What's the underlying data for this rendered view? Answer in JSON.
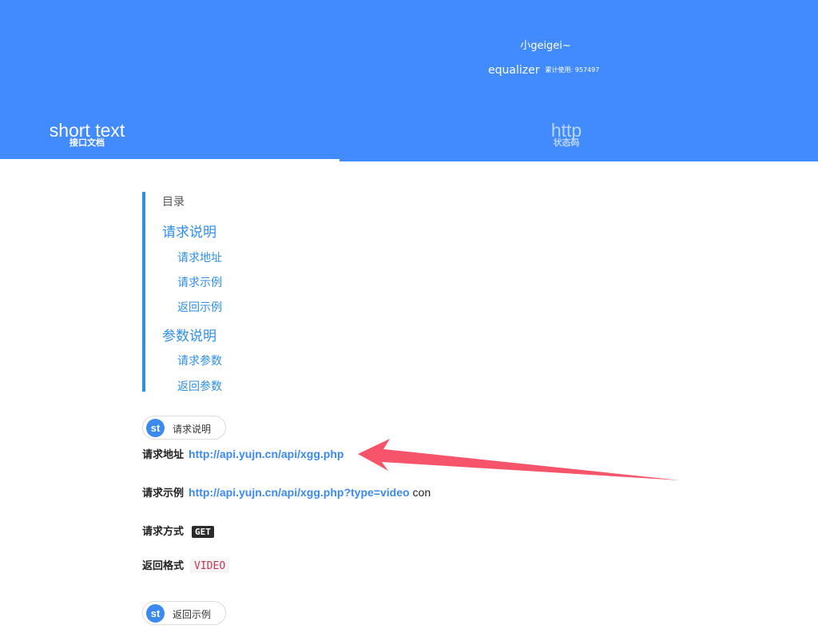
{
  "header": {
    "site_name": "小geigei~",
    "site_sub_main": "equalizer",
    "site_sub_small": "累计使用: 957497",
    "bg_color": "#418bff"
  },
  "tabs": [
    {
      "label": "short text",
      "sub": "接口文档",
      "active": true
    },
    {
      "label": "http",
      "sub": "状态码",
      "active": false
    }
  ],
  "toc": {
    "title": "目录",
    "sections": [
      {
        "label": "请求说明",
        "items": [
          "请求地址",
          "请求示例",
          "返回示例"
        ]
      },
      {
        "label": "参数说明",
        "items": [
          "请求参数",
          "返回参数"
        ]
      }
    ]
  },
  "pills": {
    "logo": "st",
    "request": "请求说明",
    "response": "返回示例"
  },
  "request": {
    "address_label": "请求地址",
    "address_url": "http://api.yujn.cn/api/xgg.php",
    "example_label": "请求示例",
    "example_url": "http://api.yujn.cn/api/xgg.php?type=video",
    "example_tail": "con",
    "method_label": "请求方式",
    "method_value": "GET",
    "format_label": "返回格式",
    "format_value": "VIDEO"
  },
  "annotation": {
    "arrow_color": "#f5546a"
  }
}
